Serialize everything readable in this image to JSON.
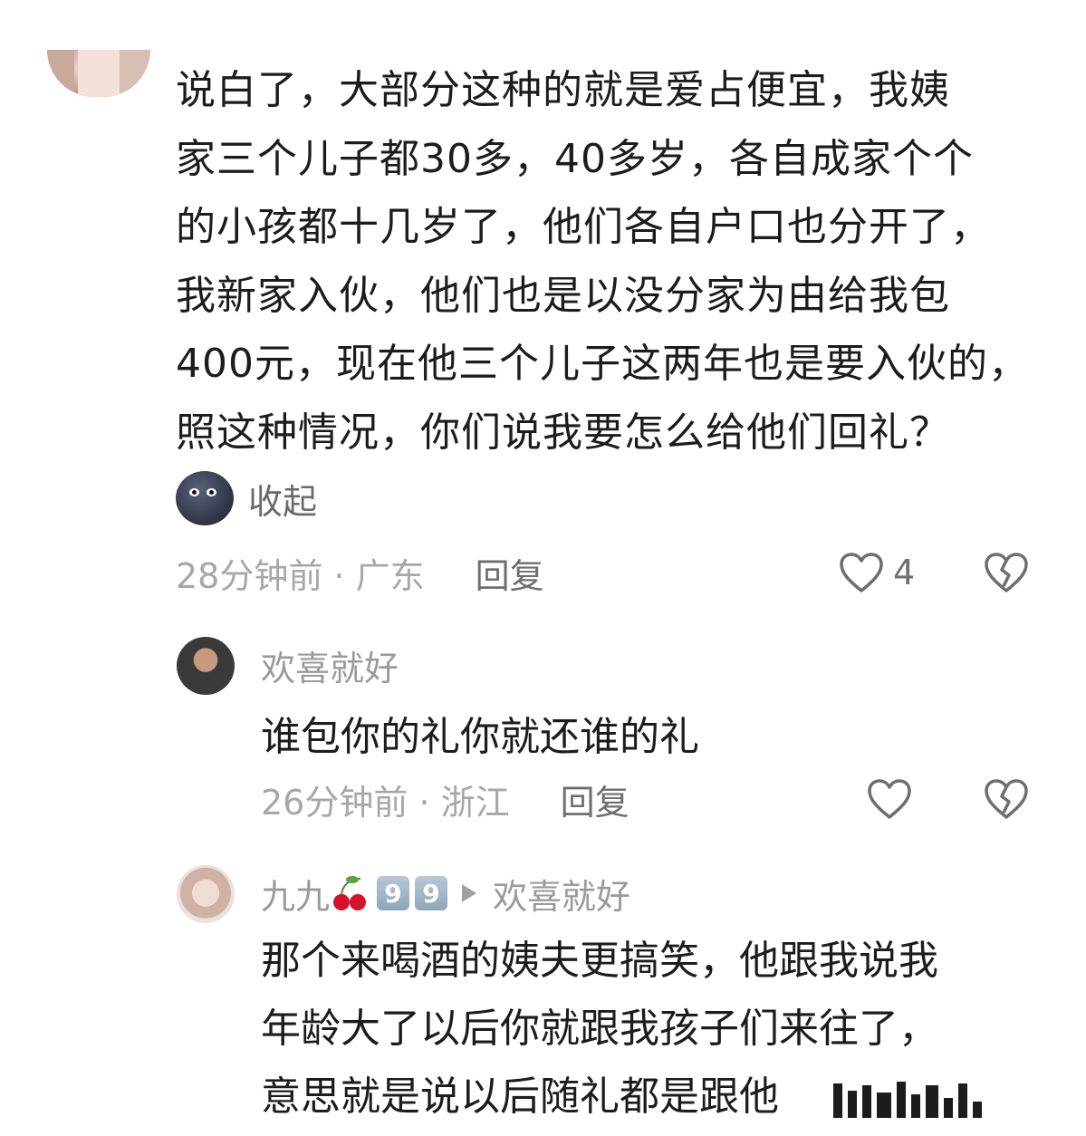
{
  "comment": {
    "lines": [
      "说白了，大部分这种的就是爱占便宜，我姨",
      "家三个儿子都30多，40多岁，各自成家个个",
      "的小孩都十几岁了，他们各自户口也分开了，",
      "我新家入伙，他们也是以没分家为由给我包",
      "400元，现在他三个儿子这两年也是要入伙的，",
      "照这种情况，你们说我要怎么给他们回礼？"
    ],
    "collapse_label": "收起",
    "time_location": "28分钟前 · 广东",
    "reply_label": "回复",
    "like_count": "4"
  },
  "replies": [
    {
      "username": "欢喜就好",
      "text": "谁包你的礼你就还谁的礼",
      "time_location": "26分钟前 · 浙江",
      "reply_label": "回复"
    },
    {
      "username": "九九",
      "badge_digits": [
        "9",
        "9"
      ],
      "reply_to": "欢喜就好",
      "lines": [
        "那个来喝酒的姨夫更搞笑，他跟我说我",
        "年龄大了以后你就跟我孩子们来往了，",
        "意思就是说以后随礼都是跟他"
      ]
    }
  ],
  "icons": {
    "like": "heart-outline-icon",
    "dislike": "broken-heart-icon",
    "collapse_emoji": "new-moon-face-emoji",
    "name_emoji": "cherries-emoji",
    "reply_arrow": "play-arrow-icon"
  },
  "colors": {
    "text_primary": "#1c1c1c",
    "text_meta": "#a7a7a7",
    "text_username": "#9a9a9a",
    "reply_action": "#6e6e6e",
    "background": "#ffffff"
  }
}
